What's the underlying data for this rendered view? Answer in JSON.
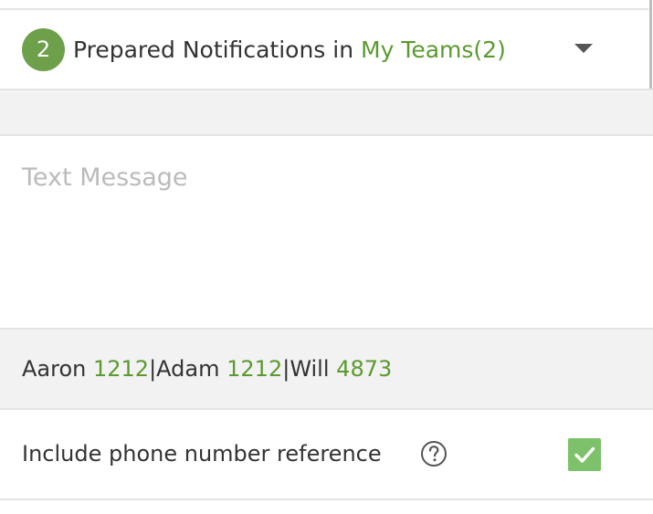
{
  "notifications": {
    "count": "2",
    "title_prefix": "Prepared Notifications in ",
    "team_link": "My Teams(2)"
  },
  "message": {
    "placeholder": "Text Message",
    "value": ""
  },
  "recipients": [
    {
      "name": "Aaron",
      "number": "1212"
    },
    {
      "name": "Adam",
      "number": "1212"
    },
    {
      "name": "Will",
      "number": "4873"
    }
  ],
  "recipient_separator": " | ",
  "options": {
    "include_phone_label": "Include phone number reference",
    "include_phone_checked": true
  },
  "colors": {
    "accent_green": "#5b9a2f",
    "badge_green": "#6e9f4a",
    "checkbox_green": "#7dc26a",
    "band_gray": "#f2f2f2"
  },
  "icons": {
    "dropdown": "chevron-down-icon",
    "help": "question-circle-icon",
    "check": "checkmark-icon"
  }
}
